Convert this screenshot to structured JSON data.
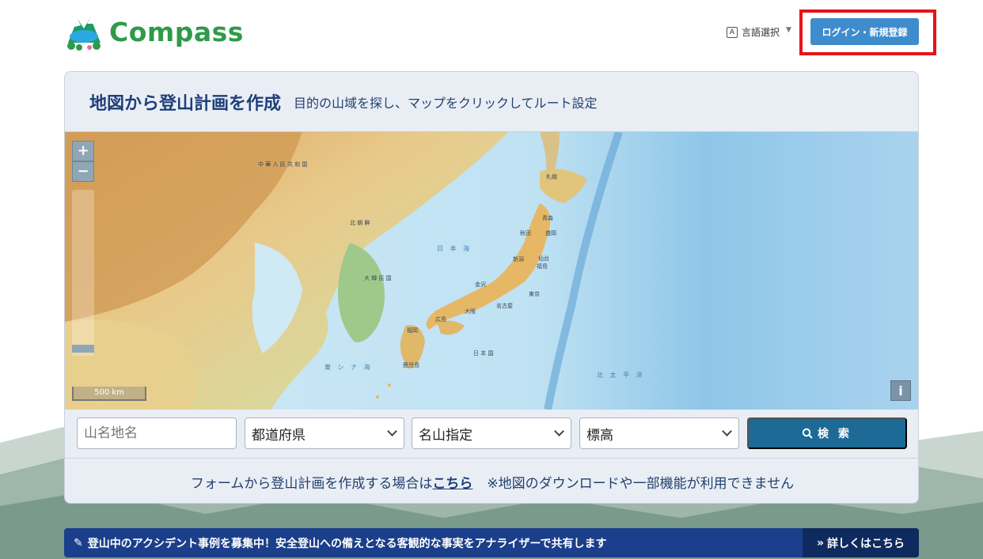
{
  "header": {
    "logo_text": "Compass",
    "lang_badge": "A",
    "lang_label": "言語選択",
    "login_label": "ログイン・新規登録"
  },
  "card": {
    "title": "地図から登山計画を作成",
    "subtitle": "目的の山域を探し、マップをクリックしてルート設定"
  },
  "map": {
    "zoom_in": "+",
    "zoom_out": "−",
    "scale_label": "500 km",
    "info_label": "i",
    "labels": {
      "china": "中 華 人 民 共 和 国",
      "north_korea": "北 朝 鮮",
      "south_korea": "大 韓 民 国",
      "sea_of_japan": "日 本 海",
      "east_china_sea": "東 シ ナ 海",
      "pacific": "北 太 平 洋",
      "japan": "日 本 国",
      "sapporo": "札幌",
      "aomori": "青森",
      "akita": "秋田",
      "morioka": "盛岡",
      "sendai": "仙台",
      "niigata": "新潟",
      "fukushima": "福島",
      "kanazawa": "金沢",
      "tokyo": "東京",
      "nagoya": "名古屋",
      "osaka": "大阪",
      "hiroshima": "広島",
      "fukuoka": "福岡",
      "kagoshima": "鹿児島"
    }
  },
  "form": {
    "mountain_placeholder": "山名地名",
    "prefecture": "都道府県",
    "famous": "名山指定",
    "elevation": "標高",
    "search_icon": "search-icon",
    "search_label": "検 索"
  },
  "note": {
    "prefix": "フォームから登山計画を作成する場合は",
    "link": "こちら",
    "suffix": "※地図のダウンロードや一部機能が利用できません"
  },
  "banner": {
    "icon": "edit-icon",
    "text": "登山中のアクシデント事例を募集中！安全登山への備えとなる客観的な事実をアナライザーで共有します",
    "more_label": "詳しくはこちら"
  },
  "colors": {
    "login_outline": "#e8121a",
    "login_button": "#3f8ccd",
    "search_button": "#1d6a96",
    "banner": "#1b3f8a",
    "brand_green": "#2e9a4a"
  }
}
